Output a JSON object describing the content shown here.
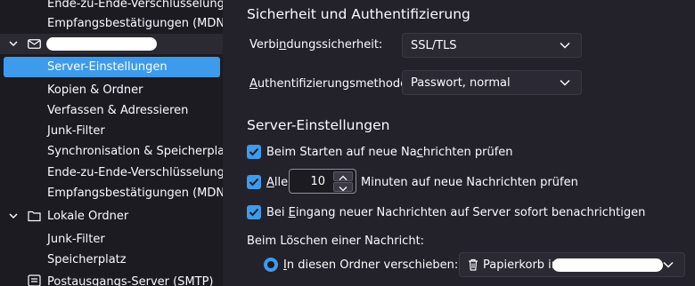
{
  "sidebar": {
    "items": [
      {
        "label": "Ende-zu-Ende-Verschlüsselung"
      },
      {
        "label": "Empfangsbestätigungen (MDN)"
      },
      {
        "label": ""
      },
      {
        "label": "Server-Einstellungen"
      },
      {
        "label": "Kopien & Ordner"
      },
      {
        "label": "Verfassen & Adressieren"
      },
      {
        "label": "Junk-Filter"
      },
      {
        "label": "Synchronisation & Speicherplatz"
      },
      {
        "label": "Ende-zu-Ende-Verschlüsselung"
      },
      {
        "label": "Empfangsbestätigungen (MDN)"
      },
      {
        "label": "Lokale Ordner"
      },
      {
        "label": "Junk-Filter"
      },
      {
        "label": "Speicherplatz"
      },
      {
        "label": "Postausgangs-Server (SMTP)"
      }
    ]
  },
  "security": {
    "heading": "Sicherheit und Authentifizierung",
    "conn_label_a": "Verbi",
    "conn_label_u": "n",
    "conn_label_b": "dungssicherheit:",
    "conn_value": "SSL/TLS",
    "auth_label_u": "A",
    "auth_label_b": "uthentifizierungsmethode:",
    "auth_value": "Passwort, normal"
  },
  "server": {
    "heading": "Server-Einstellungen",
    "check_startup_a": "Beim Starten auf neue Na",
    "check_startup_u": "c",
    "check_startup_b": "hrichten prüfen",
    "check_every_u": "A",
    "check_every_b": "lle",
    "interval_value": "10",
    "minutes_label": "Minuten auf neue Nachrichten prüfen",
    "check_notify_a": "Bei ",
    "check_notify_u": "E",
    "check_notify_b": "ingang neuer Nachrichten auf Server sofort benachrichtigen",
    "delete_label": "Beim Löschen einer Nachricht:",
    "move_u": "I",
    "move_b": "n diesen Ordner verschieben:",
    "trash_value": "Papierkorb in"
  },
  "colors": {
    "accent": "#3e9bec",
    "background": "#1c1b22",
    "panel": "#23222b"
  }
}
